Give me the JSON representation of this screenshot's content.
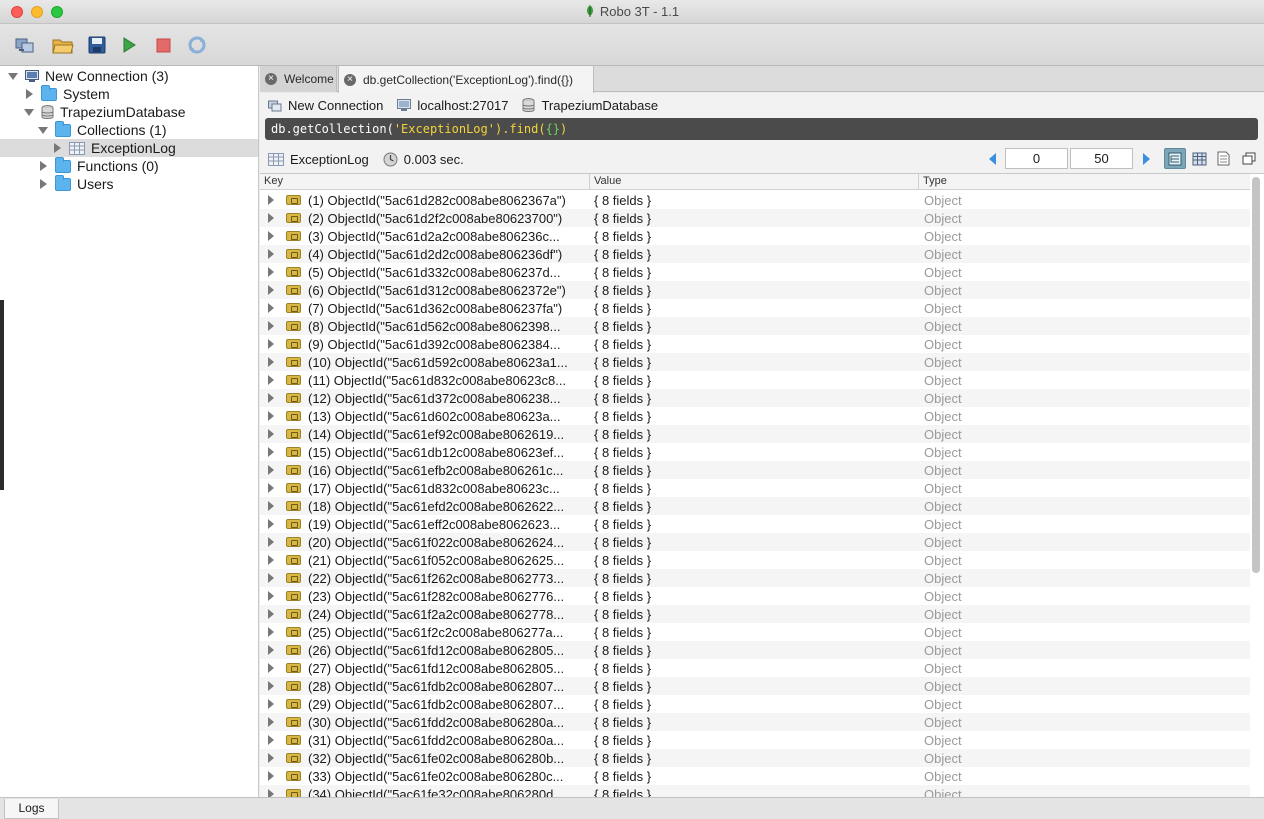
{
  "window": {
    "title": "Robo 3T - 1.1"
  },
  "toolbar": {
    "buttons": [
      "connect-icon",
      "open-icon",
      "save-icon",
      "execute-icon",
      "stop-icon",
      "refresh-icon"
    ]
  },
  "sidebar": {
    "connection": "New Connection (3)",
    "system": "System",
    "database": "TrapeziumDatabase",
    "collections": "Collections (1)",
    "collection_item": "ExceptionLog",
    "functions": "Functions (0)",
    "users": "Users"
  },
  "tabs": [
    {
      "label": "Welcome"
    },
    {
      "label": "db.getCollection('ExceptionLog').find({})"
    }
  ],
  "query_context": {
    "connection": "New Connection",
    "host": "localhost:27017",
    "database": "TrapeziumDatabase"
  },
  "query": {
    "prefix": "db.getCollection(",
    "arg": "'ExceptionLog'",
    "mid": ").find(",
    "braces": "{}",
    "suffix": ")"
  },
  "result": {
    "collection": "ExceptionLog",
    "time": "0.003 sec.",
    "skip": "0",
    "limit": "50"
  },
  "table": {
    "headers": {
      "key": "Key",
      "value": "Value",
      "type": "Type"
    },
    "rows": [
      {
        "key": "(1) ObjectId(\"5ac61d282c008abe8062367a\")",
        "value": "{ 8 fields }",
        "type": "Object"
      },
      {
        "key": "(2) ObjectId(\"5ac61d2f2c008abe80623700\")",
        "value": "{ 8 fields }",
        "type": "Object"
      },
      {
        "key": "(3) ObjectId(\"5ac61d2a2c008abe806236c...",
        "value": "{ 8 fields }",
        "type": "Object"
      },
      {
        "key": "(4) ObjectId(\"5ac61d2d2c008abe806236df\")",
        "value": "{ 8 fields }",
        "type": "Object"
      },
      {
        "key": "(5) ObjectId(\"5ac61d332c008abe806237d...",
        "value": "{ 8 fields }",
        "type": "Object"
      },
      {
        "key": "(6) ObjectId(\"5ac61d312c008abe8062372e\")",
        "value": "{ 8 fields }",
        "type": "Object"
      },
      {
        "key": "(7) ObjectId(\"5ac61d362c008abe806237fa\")",
        "value": "{ 8 fields }",
        "type": "Object"
      },
      {
        "key": "(8) ObjectId(\"5ac61d562c008abe8062398...",
        "value": "{ 8 fields }",
        "type": "Object"
      },
      {
        "key": "(9) ObjectId(\"5ac61d392c008abe8062384...",
        "value": "{ 8 fields }",
        "type": "Object"
      },
      {
        "key": "(10) ObjectId(\"5ac61d592c008abe80623a1...",
        "value": "{ 8 fields }",
        "type": "Object"
      },
      {
        "key": "(11) ObjectId(\"5ac61d832c008abe80623c8...",
        "value": "{ 8 fields }",
        "type": "Object"
      },
      {
        "key": "(12) ObjectId(\"5ac61d372c008abe806238...",
        "value": "{ 8 fields }",
        "type": "Object"
      },
      {
        "key": "(13) ObjectId(\"5ac61d602c008abe80623a...",
        "value": "{ 8 fields }",
        "type": "Object"
      },
      {
        "key": "(14) ObjectId(\"5ac61ef92c008abe8062619...",
        "value": "{ 8 fields }",
        "type": "Object"
      },
      {
        "key": "(15) ObjectId(\"5ac61db12c008abe80623ef...",
        "value": "{ 8 fields }",
        "type": "Object"
      },
      {
        "key": "(16) ObjectId(\"5ac61efb2c008abe806261c...",
        "value": "{ 8 fields }",
        "type": "Object"
      },
      {
        "key": "(17) ObjectId(\"5ac61d832c008abe80623c...",
        "value": "{ 8 fields }",
        "type": "Object"
      },
      {
        "key": "(18) ObjectId(\"5ac61efd2c008abe8062622...",
        "value": "{ 8 fields }",
        "type": "Object"
      },
      {
        "key": "(19) ObjectId(\"5ac61eff2c008abe8062623...",
        "value": "{ 8 fields }",
        "type": "Object"
      },
      {
        "key": "(20) ObjectId(\"5ac61f022c008abe8062624...",
        "value": "{ 8 fields }",
        "type": "Object"
      },
      {
        "key": "(21) ObjectId(\"5ac61f052c008abe8062625...",
        "value": "{ 8 fields }",
        "type": "Object"
      },
      {
        "key": "(22) ObjectId(\"5ac61f262c008abe8062773...",
        "value": "{ 8 fields }",
        "type": "Object"
      },
      {
        "key": "(23) ObjectId(\"5ac61f282c008abe8062776...",
        "value": "{ 8 fields }",
        "type": "Object"
      },
      {
        "key": "(24) ObjectId(\"5ac61f2a2c008abe8062778...",
        "value": "{ 8 fields }",
        "type": "Object"
      },
      {
        "key": "(25) ObjectId(\"5ac61f2c2c008abe806277a...",
        "value": "{ 8 fields }",
        "type": "Object"
      },
      {
        "key": "(26) ObjectId(\"5ac61fd12c008abe8062805...",
        "value": "{ 8 fields }",
        "type": "Object"
      },
      {
        "key": "(27) ObjectId(\"5ac61fd12c008abe8062805...",
        "value": "{ 8 fields }",
        "type": "Object"
      },
      {
        "key": "(28) ObjectId(\"5ac61fdb2c008abe8062807...",
        "value": "{ 8 fields }",
        "type": "Object"
      },
      {
        "key": "(29) ObjectId(\"5ac61fdb2c008abe8062807...",
        "value": "{ 8 fields }",
        "type": "Object"
      },
      {
        "key": "(30) ObjectId(\"5ac61fdd2c008abe806280a...",
        "value": "{ 8 fields }",
        "type": "Object"
      },
      {
        "key": "(31) ObjectId(\"5ac61fdd2c008abe806280a...",
        "value": "{ 8 fields }",
        "type": "Object"
      },
      {
        "key": "(32) ObjectId(\"5ac61fe02c008abe806280b...",
        "value": "{ 8 fields }",
        "type": "Object"
      },
      {
        "key": "(33) ObjectId(\"5ac61fe02c008abe806280c...",
        "value": "{ 8 fields }",
        "type": "Object"
      },
      {
        "key": "(34) ObjectId(\"5ac61fe32c008abe806280d...",
        "value": "{ 8 fields }",
        "type": "Object"
      }
    ]
  },
  "bottom": {
    "logs_tab": "Logs"
  },
  "colors": {
    "accent_leaf": "#3c9a3c",
    "folder": "#5db3ee",
    "query_bg": "#4b4b4b",
    "query_string": "#f3d43b",
    "selected_view": "#7aa6b8"
  }
}
